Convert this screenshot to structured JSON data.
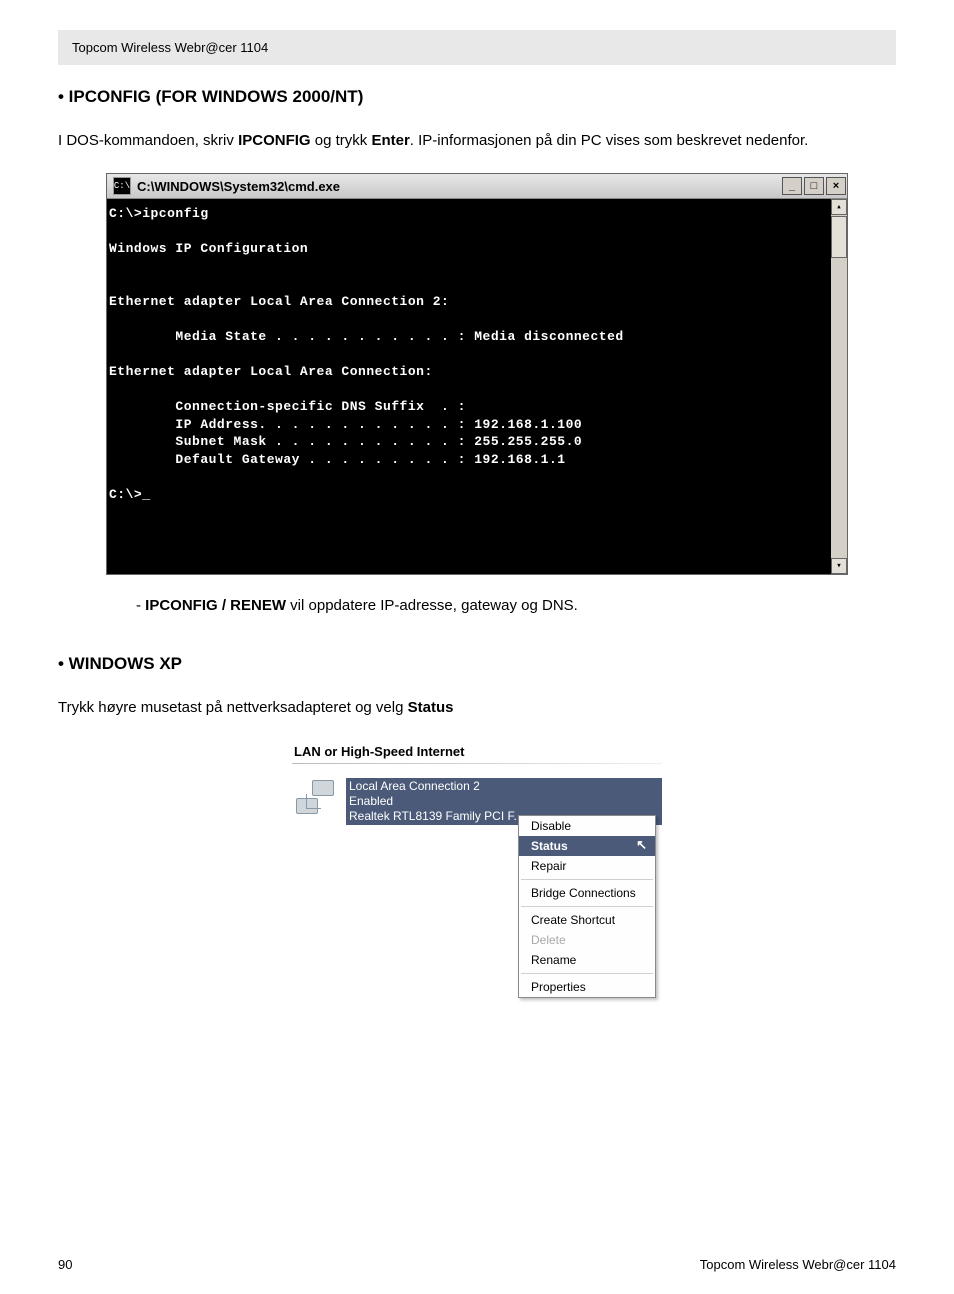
{
  "header": {
    "product": "Topcom Wireless Webr@cer 1104"
  },
  "section1": {
    "heading": "• IPCONFIG (FOR WINDOWS 2000/NT)",
    "intro_pre": "I DOS-kommandoen, skriv ",
    "intro_bold1": "IPCONFIG",
    "intro_mid": " og trykk ",
    "intro_bold2": "Enter",
    "intro_post": ". IP-informasjonen på din PC vises som beskrevet nedenfor."
  },
  "cmd": {
    "title": "C:\\WINDOWS\\System32\\cmd.exe",
    "sysicon_label": "C:\\",
    "btn_min": "_",
    "btn_max": "□",
    "btn_close": "×",
    "scroll_up": "▴",
    "scroll_down": "▾",
    "output": "C:\\>ipconfig\n\nWindows IP Configuration\n\n\nEthernet adapter Local Area Connection 2:\n\n        Media State . . . . . . . . . . . : Media disconnected\n\nEthernet adapter Local Area Connection:\n\n        Connection-specific DNS Suffix  . :\n        IP Address. . . . . . . . . . . . : 192.168.1.100\n        Subnet Mask . . . . . . . . . . . : 255.255.255.0\n        Default Gateway . . . . . . . . . : 192.168.1.1\n\nC:\\>_"
  },
  "renew_note": {
    "prefix": "- ",
    "bold": "IPCONFIG / RENEW",
    "rest": " vil oppdatere IP-adresse, gateway og DNS."
  },
  "section2": {
    "heading": "• WINDOWS XP",
    "intro_pre": "Trykk høyre musetast på nettverksadapteret og velg ",
    "intro_bold": "Status"
  },
  "lan": {
    "header": "LAN or High-Speed Internet",
    "conn_line1": "Local Area Connection 2",
    "conn_line2": "Enabled",
    "conn_line3": "Realtek RTL8139 Family PCI F..."
  },
  "menu": {
    "disable": "Disable",
    "status": "Status",
    "repair": "Repair",
    "bridge": "Bridge Connections",
    "shortcut": "Create Shortcut",
    "delete": "Delete",
    "rename": "Rename",
    "properties": "Properties",
    "cursor_glyph": "↖"
  },
  "footer": {
    "page_number": "90",
    "product": "Topcom Wireless Webr@cer 1104"
  }
}
